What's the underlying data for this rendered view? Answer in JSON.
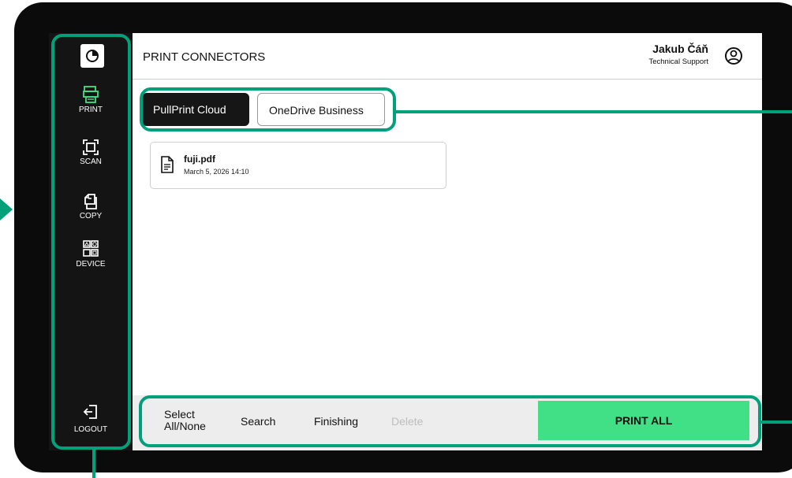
{
  "app": {
    "title": "PRINT CONNECTORS"
  },
  "user": {
    "name": "Jakub Čáň",
    "role": "Technical Support",
    "avatar_icon": "user-circle-icon"
  },
  "logo_icon": "app-logo-icon",
  "sidebar": {
    "items": [
      {
        "label": "PRINT",
        "icon": "printer-icon",
        "active": true
      },
      {
        "label": "SCAN",
        "icon": "scan-frame-icon",
        "active": false
      },
      {
        "label": "COPY",
        "icon": "copy-documents-icon",
        "active": false
      },
      {
        "label": "DEVICE",
        "icon": "device-grid-icon",
        "active": false
      }
    ],
    "logout": {
      "label": "LOGOUT",
      "icon": "logout-icon"
    }
  },
  "tabs": [
    {
      "label": "PullPrint Cloud",
      "active": true
    },
    {
      "label": "OneDrive Business",
      "active": false
    }
  ],
  "files": [
    {
      "name": "fuji.pdf",
      "date": "March 5, 2026 14:10",
      "icon": "document-icon"
    }
  ],
  "toolbar": {
    "select_label_line1": "Select",
    "select_label_line2": "All/None",
    "search_label": "Search",
    "finishing_label": "Finishing",
    "delete_label": "Delete",
    "print_all_label": "PRINT ALL"
  },
  "colors": {
    "accent": "#41e086",
    "callout": "#00a07a",
    "sidebar_bg": "#141414",
    "active_icon": "#41e086"
  }
}
